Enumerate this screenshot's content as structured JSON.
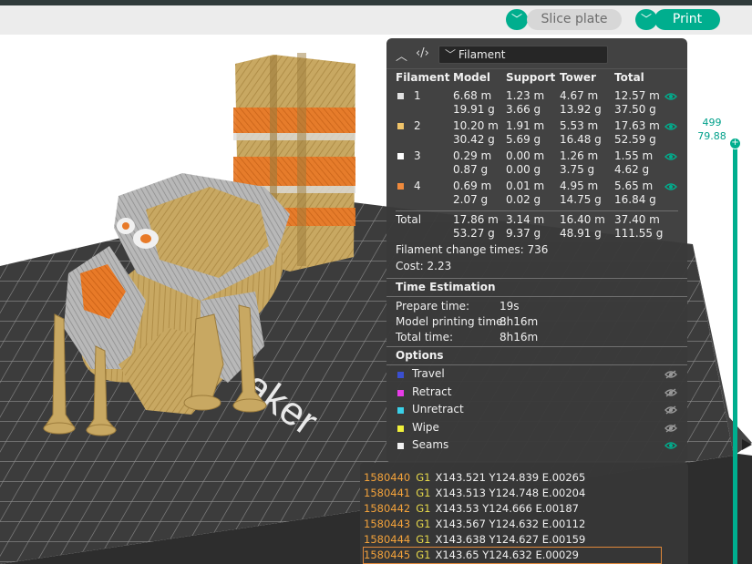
{
  "toolbar": {
    "slice_label": "Slice plate",
    "print_label": "Print",
    "dropdown_glyph": "﹀"
  },
  "layer_slider": {
    "layer": "499",
    "height": "79.88",
    "accent": "#00ae8e"
  },
  "stats": {
    "view_select": "Filament",
    "columns": [
      "Filament",
      "Model",
      "Support",
      "Tower",
      "Total"
    ],
    "filaments": [
      {
        "id": "1",
        "color": "#e2e2e2",
        "model": [
          "6.68 m",
          "19.91 g"
        ],
        "support": [
          "1.23 m",
          "3.66 g"
        ],
        "tower": [
          "4.67 m",
          "13.92 g"
        ],
        "total": [
          "12.57 m",
          "37.50 g"
        ],
        "visible": true
      },
      {
        "id": "2",
        "color": "#f0c46a",
        "model": [
          "10.20 m",
          "30.42 g"
        ],
        "support": [
          "1.91 m",
          "5.69 g"
        ],
        "tower": [
          "5.53 m",
          "16.48 g"
        ],
        "total": [
          "17.63 m",
          "52.59 g"
        ],
        "visible": true
      },
      {
        "id": "3",
        "color": "#ffffff",
        "model": [
          "0.29 m",
          "0.87 g"
        ],
        "support": [
          "0.00 m",
          "0.00 g"
        ],
        "tower": [
          "1.26 m",
          "3.75 g"
        ],
        "total": [
          "1.55 m",
          "4.62 g"
        ],
        "visible": true
      },
      {
        "id": "4",
        "color": "#f08a3c",
        "model": [
          "0.69 m",
          "2.07 g"
        ],
        "support": [
          "0.01 m",
          "0.02 g"
        ],
        "tower": [
          "4.95 m",
          "14.75 g"
        ],
        "total": [
          "5.65 m",
          "16.84 g"
        ],
        "visible": true
      }
    ],
    "total": {
      "label": "Total",
      "model": [
        "17.86 m",
        "53.27 g"
      ],
      "support": [
        "3.14 m",
        "9.37 g"
      ],
      "tower": [
        "16.40 m",
        "48.91 g"
      ],
      "total": [
        "37.40 m",
        "111.55 g"
      ]
    },
    "filament_change": "Filament change times:  736",
    "cost": "Cost:  2.23",
    "time_section": {
      "title": "Time Estimation",
      "rows": [
        {
          "label": "Prepare time:",
          "value": "19s"
        },
        {
          "label": "Model printing time:",
          "value": "8h16m"
        },
        {
          "label": "Total time:",
          "value": "8h16m"
        }
      ]
    },
    "options_section": {
      "title": "Options",
      "items": [
        {
          "label": "Travel",
          "color": "#3a4fd0",
          "visible": false
        },
        {
          "label": "Retract",
          "color": "#e83ce8",
          "visible": false
        },
        {
          "label": "Unretract",
          "color": "#3ad0e8",
          "visible": false
        },
        {
          "label": "Wipe",
          "color": "#f0f03a",
          "visible": false
        },
        {
          "label": "Seams",
          "color": "#f2f2f2",
          "visible": true
        }
      ]
    }
  },
  "gcode": {
    "lines": [
      {
        "n": "1580440",
        "cmd": "G1",
        "args": "X143.521 Y124.839 E.00265"
      },
      {
        "n": "1580441",
        "cmd": "G1",
        "args": "X143.513 Y124.748 E.00204"
      },
      {
        "n": "1580442",
        "cmd": "G1",
        "args": "X143.53 Y124.666 E.00187"
      },
      {
        "n": "1580443",
        "cmd": "G1",
        "args": "X143.567 Y124.632 E.00112"
      },
      {
        "n": "1580444",
        "cmd": "G1",
        "args": "X143.638 Y124.627 E.00159"
      },
      {
        "n": "1580445",
        "cmd": "G1",
        "args": "X143.65 Y124.632 E.00029",
        "selected": true
      }
    ]
  },
  "plate_text": "aker"
}
